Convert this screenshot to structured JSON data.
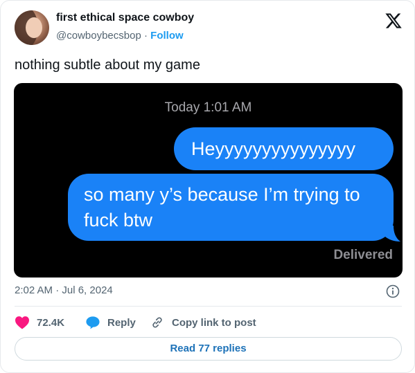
{
  "author": {
    "display_name": "first ethical space cowboy",
    "handle": "@cowboybecsbop",
    "separator": "·",
    "follow_label": "Follow"
  },
  "tweet": {
    "text": "nothing subtle about my game",
    "media": {
      "timestamp": "Today 1:01 AM",
      "messages": [
        "Heyyyyyyyyyyyyyyy",
        "so many y’s because I’m trying to fuck btw"
      ],
      "status": "Delivered"
    },
    "posted_at": "2:02 AM · Jul 6, 2024"
  },
  "actions": {
    "likes": "72.4K",
    "reply_label": "Reply",
    "copy_label": "Copy link to post",
    "read_replies_label": "Read 77 replies"
  },
  "icons": {
    "brand": "x-logo-icon",
    "like": "heart-icon",
    "reply": "speech-bubble-icon",
    "copy": "link-icon",
    "info": "info-icon"
  },
  "colors": {
    "accent": "#1d9bf0",
    "like": "#f91880",
    "imessage_blue": "#1a82f7",
    "muted_text": "#536471"
  }
}
